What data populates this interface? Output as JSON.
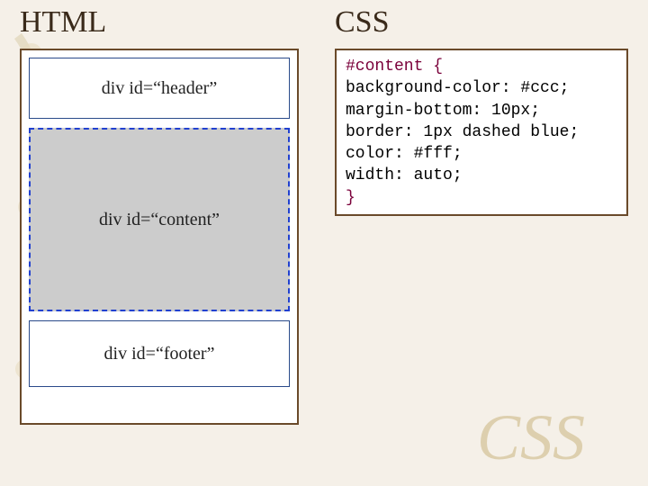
{
  "left_heading": "HTML",
  "right_heading": "CSS",
  "layout": {
    "header_label": "div id=“header”",
    "content_label": "div id=“content”",
    "footer_label": "div id=“footer”"
  },
  "css": {
    "selector": "#content",
    "rules": [
      "background-color: #ccc;",
      "margin-bottom: 10px;",
      "border: 1px dashed blue;",
      "color: #fff;",
      "width: auto;"
    ]
  },
  "watermark": "CSS"
}
